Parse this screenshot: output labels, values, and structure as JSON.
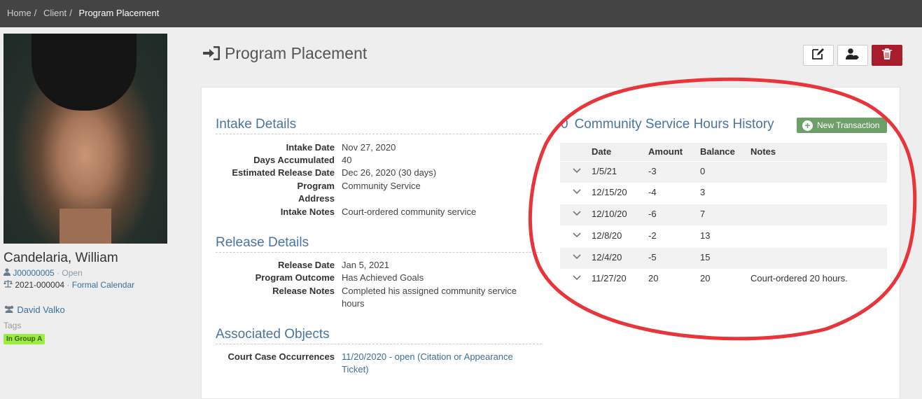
{
  "breadcrumb": {
    "home": "Home",
    "client": "Client",
    "current": "Program Placement",
    "separator": "/"
  },
  "page": {
    "title": "Program Placement"
  },
  "client": {
    "name": "Candelaria, William",
    "case_id": "J00000005",
    "case_status": "· Open",
    "docket": "2021-000004",
    "docket_sep": "·",
    "calendar": "Formal Calendar",
    "officer": "David Valko",
    "tags_label": "Tags",
    "tags": [
      "In Group A"
    ]
  },
  "intake": {
    "title": "Intake Details",
    "rows": [
      {
        "label": "Intake Date",
        "value": "Nov 27, 2020"
      },
      {
        "label": "Days Accumulated",
        "value": "40"
      },
      {
        "label": "Estimated Release Date",
        "value": "Dec 26, 2020 (30 days)"
      },
      {
        "label": "Program",
        "value": "Community Service"
      },
      {
        "label": "Address",
        "value": ""
      },
      {
        "label": "Intake Notes",
        "value": "Court-ordered community service"
      }
    ]
  },
  "release": {
    "title": "Release Details",
    "rows": [
      {
        "label": "Release Date",
        "value": "Jan 5, 2021"
      },
      {
        "label": "Program Outcome",
        "value": "Has Achieved Goals"
      },
      {
        "label": "Release Notes",
        "value": "Completed his assigned community service hours"
      }
    ]
  },
  "associated": {
    "title": "Associated Objects",
    "rows": [
      {
        "label": "Court Case Occurrences",
        "value": "11/20/2020 - open (Citation or Appearance Ticket)"
      }
    ]
  },
  "history": {
    "count": "0",
    "title": "Community Service Hours History",
    "new_button": "New Transaction",
    "columns": [
      "Date",
      "Amount",
      "Balance",
      "Notes"
    ],
    "rows": [
      {
        "date": "1/5/21",
        "amount": "-3",
        "balance": "0",
        "notes": ""
      },
      {
        "date": "12/15/20",
        "amount": "-4",
        "balance": "3",
        "notes": ""
      },
      {
        "date": "12/10/20",
        "amount": "-6",
        "balance": "7",
        "notes": ""
      },
      {
        "date": "12/8/20",
        "amount": "-2",
        "balance": "13",
        "notes": ""
      },
      {
        "date": "12/4/20",
        "amount": "-5",
        "balance": "15",
        "notes": ""
      },
      {
        "date": "11/27/20",
        "amount": "20",
        "balance": "20",
        "notes": "Court-ordered 20 hours."
      }
    ]
  },
  "colors": {
    "topbar": "#444444",
    "link": "#3a6f9a",
    "heading": "#4a74a0",
    "danger": "#a81d2e",
    "success": "#6e9f6a",
    "tag": "#9bee40",
    "annotation": "#e8353b"
  },
  "icons": [
    "sign-in-icon",
    "edit-icon",
    "user-tag-icon",
    "trash-icon",
    "user-icon",
    "balance-scale-icon",
    "users-icon",
    "plus-circle-icon",
    "chevron-down-icon"
  ]
}
